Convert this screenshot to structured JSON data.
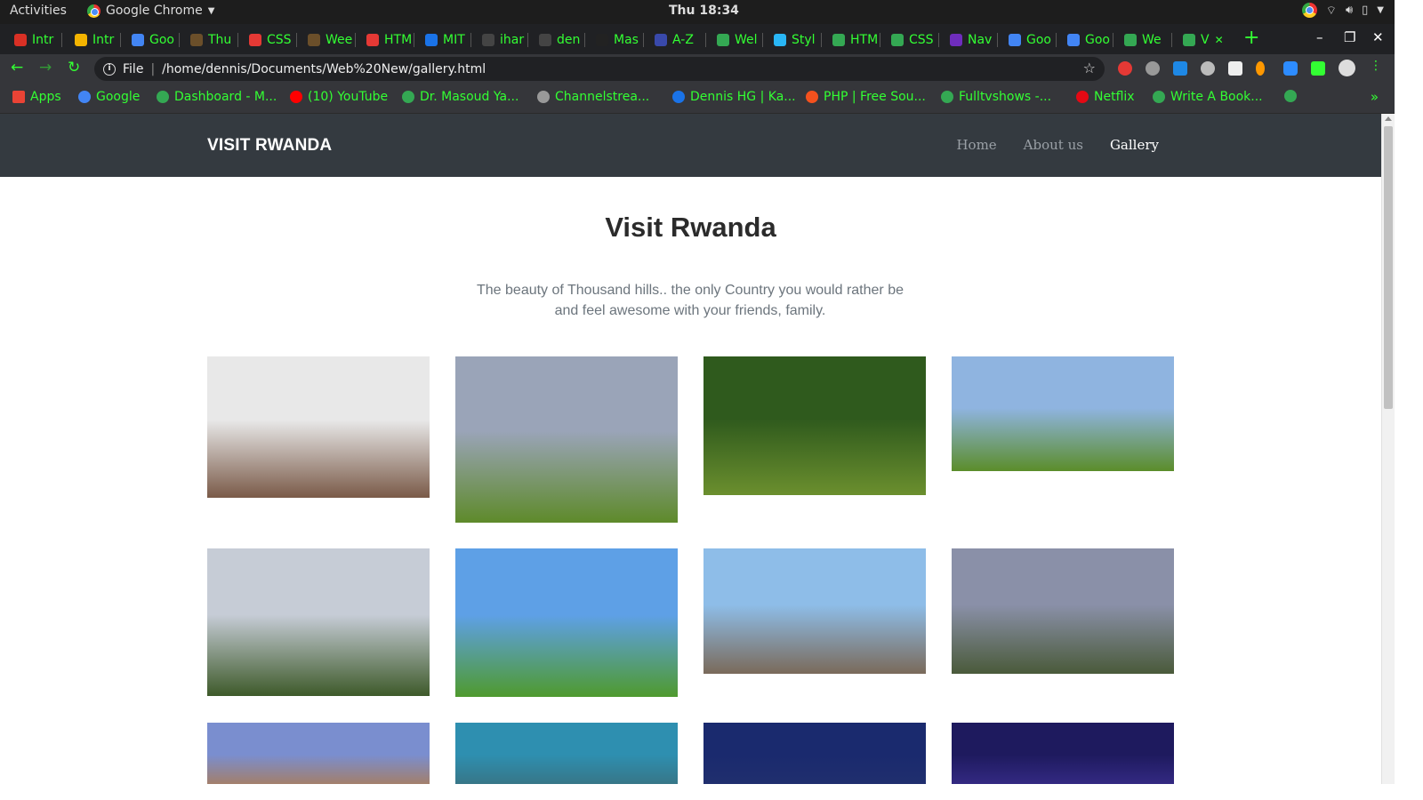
{
  "system": {
    "activities": "Activities",
    "app_name": "Google Chrome",
    "clock": "Thu 18:34"
  },
  "tabs": [
    {
      "label": "Intr",
      "color": "#d93025"
    },
    {
      "label": "Intr",
      "color": "#f4b400"
    },
    {
      "label": "Goo",
      "color": "#4285f4"
    },
    {
      "label": "Thu",
      "color": "#6b4f2a"
    },
    {
      "label": "CSS",
      "color": "#e53935"
    },
    {
      "label": "Wee",
      "color": "#6b4f2a"
    },
    {
      "label": "HTM",
      "color": "#e53935"
    },
    {
      "label": "MIT",
      "color": "#1a73e8"
    },
    {
      "label": "ihar",
      "color": "#444444"
    },
    {
      "label": "den",
      "color": "#444444"
    },
    {
      "label": "Mas",
      "color": "#222222"
    },
    {
      "label": "A-Z",
      "color": "#3949ab"
    },
    {
      "label": "Wel",
      "color": "#34a853"
    },
    {
      "label": "Styl",
      "color": "#29b6f6"
    },
    {
      "label": "HTM",
      "color": "#34a853"
    },
    {
      "label": "CSS",
      "color": "#34a853"
    },
    {
      "label": "Nav",
      "color": "#6f2dbd"
    },
    {
      "label": "Goo",
      "color": "#4285f4"
    },
    {
      "label": "Goo",
      "color": "#4285f4"
    },
    {
      "label": "We",
      "color": "#34a853"
    },
    {
      "label": "V",
      "color": "#34a853"
    }
  ],
  "address": {
    "scheme_label": "File",
    "url": "/home/dennis/Documents/Web%20New/gallery.html"
  },
  "bookmarks": [
    {
      "label": "Apps",
      "color": "#ea4335"
    },
    {
      "label": "Google",
      "color": "#4285f4"
    },
    {
      "label": "Dashboard - M...",
      "color": "#34a853"
    },
    {
      "label": "(10) YouTube",
      "color": "#ff0000"
    },
    {
      "label": "Dr. Masoud Ya...",
      "color": "#34a853"
    },
    {
      "label": "Channelstrea...",
      "color": "#999999"
    },
    {
      "label": "Dennis HG | Ka...",
      "color": "#1a73e8"
    },
    {
      "label": "PHP | Free Sou...",
      "color": "#f4511e"
    },
    {
      "label": "Fulltvshows -...",
      "color": "#34a853"
    },
    {
      "label": "Netflix",
      "color": "#e50914"
    },
    {
      "label": "Write A Book...",
      "color": "#34a853"
    },
    {
      "label": "",
      "color": "#34a853"
    }
  ],
  "site": {
    "brand": "VISIT RWANDA",
    "nav": [
      "Home",
      "About us",
      "Gallery"
    ],
    "title": "Visit Rwanda",
    "subtitle": "The beauty of Thousand hills.. the only Country you would rather be and feel awesome with your friends, family."
  },
  "gallery": [
    {
      "name": "photo-visit-rwanda-signs",
      "sky": "#e8e8e8",
      "ground": "#7a5a48"
    },
    {
      "name": "photo-volcano-farmland",
      "sky": "#9aa4b8",
      "ground": "#5e8a2a"
    },
    {
      "name": "photo-gorilla-forest",
      "sky": "#2f5a1d",
      "ground": "#6b8f2e"
    },
    {
      "name": "photo-intore-dancers",
      "sky": "#8fb4e0",
      "ground": "#5b8d2a"
    },
    {
      "name": "photo-lake-kivu-huts",
      "sky": "#c6ccd6",
      "ground": "#3e5a2a"
    },
    {
      "name": "photo-street-gardener",
      "sky": "#5ea0e6",
      "ground": "#4f9a2e"
    },
    {
      "name": "photo-kigali-skyline",
      "sky": "#8ebde8",
      "ground": "#7a6a5a"
    },
    {
      "name": "photo-kigali-city-aerial",
      "sky": "#8a90a8",
      "ground": "#4a5a3a"
    },
    {
      "name": "photo-convention-centre",
      "sky": "#7a8ecf",
      "ground": "#b07a4a"
    },
    {
      "name": "photo-city-panorama",
      "sky": "#2e8fb0",
      "ground": "#3a6e7a"
    },
    {
      "name": "photo-night-sky",
      "sky": "#1a2a6e",
      "ground": "#22306e"
    },
    {
      "name": "photo-dome-night",
      "sky": "#1e1a5e",
      "ground": "#3a2e8e"
    }
  ]
}
